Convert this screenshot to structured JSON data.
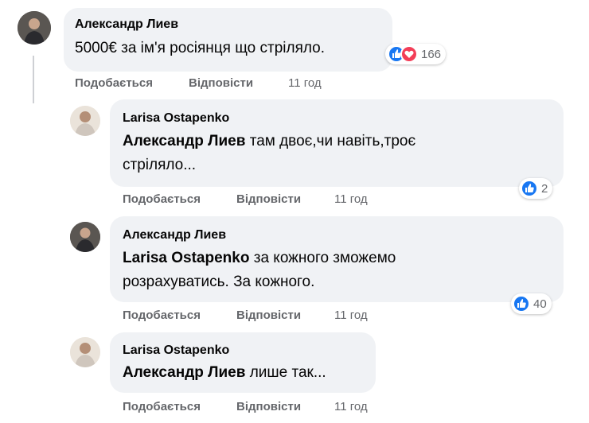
{
  "comments": [
    {
      "author": "Александр Лиев",
      "mention": "",
      "text": "5000€ за ім'я росіянця що стріляло.",
      "reaction_count": "166",
      "like_label": "Подобається",
      "reply_label": "Відповісти",
      "time": "11 год"
    },
    {
      "author": "Larisa Ostapenko",
      "mention": "Александр Лиев",
      "text_line1": "там двоє,чи навіть,троє",
      "text_line2": "стріляло...",
      "reaction_count": "2",
      "like_label": "Подобається",
      "reply_label": "Відповісти",
      "time": "11 год"
    },
    {
      "author": "Александр Лиев",
      "mention": "Larisa Ostapenko",
      "text_line1": "за кожного зможемо",
      "text_line2": "розрахуватись. За кожного.",
      "reaction_count": "40",
      "like_label": "Подобається",
      "reply_label": "Відповісти",
      "time": "11 год"
    },
    {
      "author": "Larisa Ostapenko",
      "mention": "Александр Лиев",
      "text_line1": "лише так...",
      "like_label": "Подобається",
      "reply_label": "Відповісти",
      "time": "11 год"
    }
  ],
  "colors": {
    "bubble": "#f0f2f5",
    "like_blue": "#1877f2",
    "love_red": "#f33e58",
    "meta_gray": "#65676b"
  }
}
